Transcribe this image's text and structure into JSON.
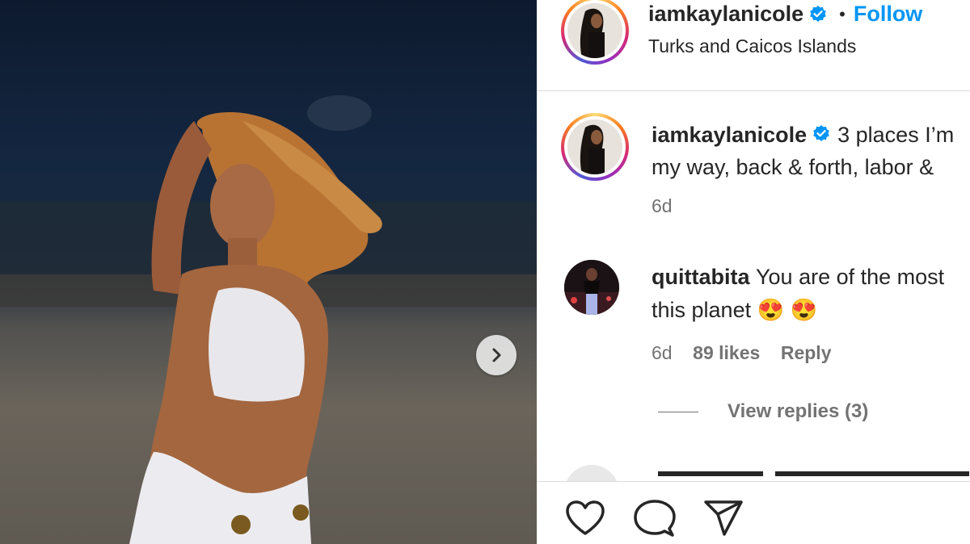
{
  "post": {
    "photo": {
      "alt_icon": "chevron-right-icon"
    },
    "header": {
      "username": "iamkaylanicole",
      "separator": "•",
      "follow_label": "Follow",
      "location": "Turks and Caicos Islands"
    },
    "caption": {
      "username": "iamkaylanicole",
      "line1": "3 places I’m",
      "line2": "my way, back & forth, labor &",
      "time": "6d"
    },
    "comments": [
      {
        "username": "quittabita",
        "line1": "You are of the most",
        "line2": "this planet 😍 😍",
        "time": "6d",
        "likes": "89 likes",
        "reply_label": "Reply",
        "view_replies": "View replies (3)"
      }
    ],
    "actions": {
      "like_icon": "heart-icon",
      "comment_icon": "comment-icon",
      "share_icon": "share-icon"
    },
    "colors": {
      "accent": "#0095f6",
      "verified": "#0095f6",
      "muted": "#737373"
    }
  }
}
